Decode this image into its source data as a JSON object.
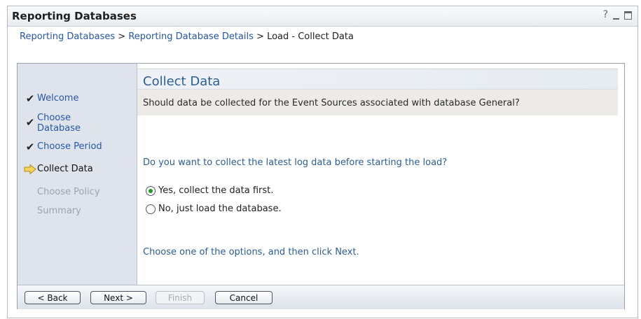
{
  "window": {
    "title": "Reporting Databases",
    "help_label": "?"
  },
  "breadcrumb": {
    "items": [
      "Reporting Databases",
      "Reporting Database Details"
    ],
    "separator": ">",
    "current": "Load - Collect Data"
  },
  "steps": [
    {
      "label": "Welcome",
      "state": "done"
    },
    {
      "label": "Choose Database",
      "state": "done"
    },
    {
      "label": "Choose Period",
      "state": "done"
    },
    {
      "label": "Collect Data",
      "state": "current"
    },
    {
      "label": "Choose Policy",
      "state": "todo"
    },
    {
      "label": "Summary",
      "state": "todo"
    }
  ],
  "content": {
    "heading": "Collect Data",
    "subheading": "Should data be collected for the Event Sources associated with database General?",
    "question": "Do you want to collect the latest log data before starting the load?",
    "options": [
      {
        "label": "Yes, collect the data first.",
        "selected": true
      },
      {
        "label": "No, just load the database.",
        "selected": false
      }
    ],
    "hint": "Choose one of the options, and then click Next."
  },
  "buttons": {
    "back": "< Back",
    "next": "Next >",
    "finish": "Finish",
    "cancel": "Cancel"
  },
  "colors": {
    "link": "#2557a7",
    "heading": "#2b5e93",
    "selected_radio": "#1e9b1e"
  }
}
